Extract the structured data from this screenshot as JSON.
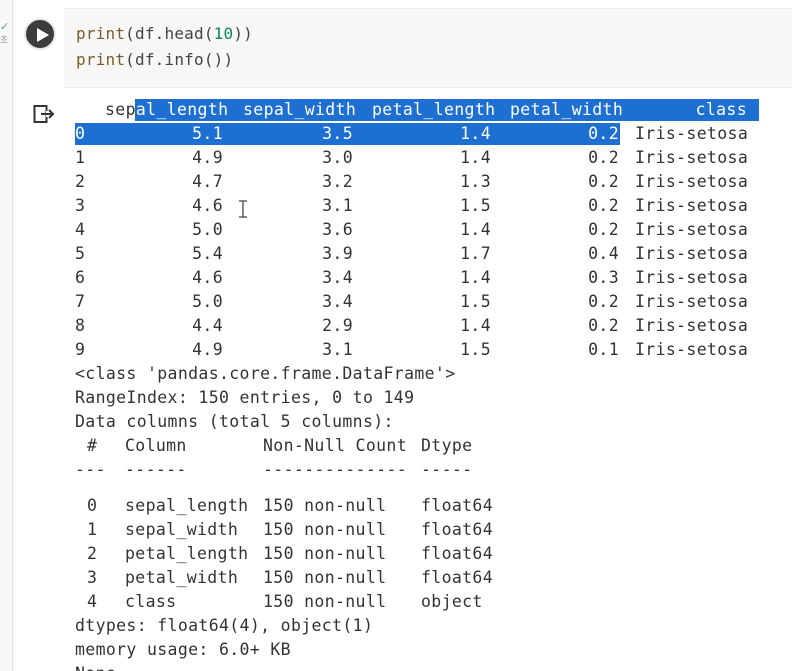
{
  "cell": {
    "status_symbol": "✓",
    "status_sub": "초",
    "code_lines": [
      {
        "fn": "print",
        "open": "(df.head(",
        "num": "10",
        "close": "))"
      },
      {
        "fn": "print",
        "open": "(df.info())",
        "num": "",
        "close": ""
      }
    ]
  },
  "icons": {
    "run": "play-icon",
    "output": "output-arrow-icon",
    "cursor": "text-cursor-icon"
  },
  "colors": {
    "selection": "#1e6fd2",
    "run_button": "#3c3c3c",
    "code_background": "#f7f7f7"
  },
  "dataframe": {
    "headers": [
      "sepal_length",
      "sepal_width",
      "petal_length",
      "petal_width",
      "class"
    ],
    "header_prefix": "sep",
    "header_first_rest": "al_length",
    "rows": [
      {
        "idx": "0",
        "sl": "5.1",
        "sw": "3.5",
        "pl": "1.4",
        "pw": "0.2",
        "cls": "Iris-setosa"
      },
      {
        "idx": "1",
        "sl": "4.9",
        "sw": "3.0",
        "pl": "1.4",
        "pw": "0.2",
        "cls": "Iris-setosa"
      },
      {
        "idx": "2",
        "sl": "4.7",
        "sw": "3.2",
        "pl": "1.3",
        "pw": "0.2",
        "cls": "Iris-setosa"
      },
      {
        "idx": "3",
        "sl": "4.6",
        "sw": "3.1",
        "pl": "1.5",
        "pw": "0.2",
        "cls": "Iris-setosa"
      },
      {
        "idx": "4",
        "sl": "5.0",
        "sw": "3.6",
        "pl": "1.4",
        "pw": "0.2",
        "cls": "Iris-setosa"
      },
      {
        "idx": "5",
        "sl": "5.4",
        "sw": "3.9",
        "pl": "1.7",
        "pw": "0.4",
        "cls": "Iris-setosa"
      },
      {
        "idx": "6",
        "sl": "4.6",
        "sw": "3.4",
        "pl": "1.4",
        "pw": "0.3",
        "cls": "Iris-setosa"
      },
      {
        "idx": "7",
        "sl": "5.0",
        "sw": "3.4",
        "pl": "1.5",
        "pw": "0.2",
        "cls": "Iris-setosa"
      },
      {
        "idx": "8",
        "sl": "4.4",
        "sw": "2.9",
        "pl": "1.4",
        "pw": "0.2",
        "cls": "Iris-setosa"
      },
      {
        "idx": "9",
        "sl": "4.9",
        "sw": "3.1",
        "pl": "1.5",
        "pw": "0.1",
        "cls": "Iris-setosa"
      }
    ]
  },
  "info": {
    "class_line": "<class 'pandas.core.frame.DataFrame'>",
    "range_index": "RangeIndex: 150 entries, 0 to 149",
    "data_columns": "Data columns (total 5 columns):",
    "table_headers": [
      "#",
      "Column",
      "Non-Null Count",
      "Dtype"
    ],
    "table_rules": [
      "---",
      "------",
      "--------------",
      "-----"
    ],
    "table_rows": [
      {
        "num": "0",
        "col": "sepal_length",
        "count": "150 non-null",
        "dtype": "float64"
      },
      {
        "num": "1",
        "col": "sepal_width",
        "count": "150 non-null",
        "dtype": "float64"
      },
      {
        "num": "2",
        "col": "petal_length",
        "count": "150 non-null",
        "dtype": "float64"
      },
      {
        "num": "3",
        "col": "petal_width",
        "count": "150 non-null",
        "dtype": "float64"
      },
      {
        "num": "4",
        "col": "class",
        "count": "150 non-null",
        "dtype": "object"
      }
    ],
    "dtypes": "dtypes: float64(4), object(1)",
    "memory": "memory usage: 6.0+ KB",
    "none": "None"
  }
}
